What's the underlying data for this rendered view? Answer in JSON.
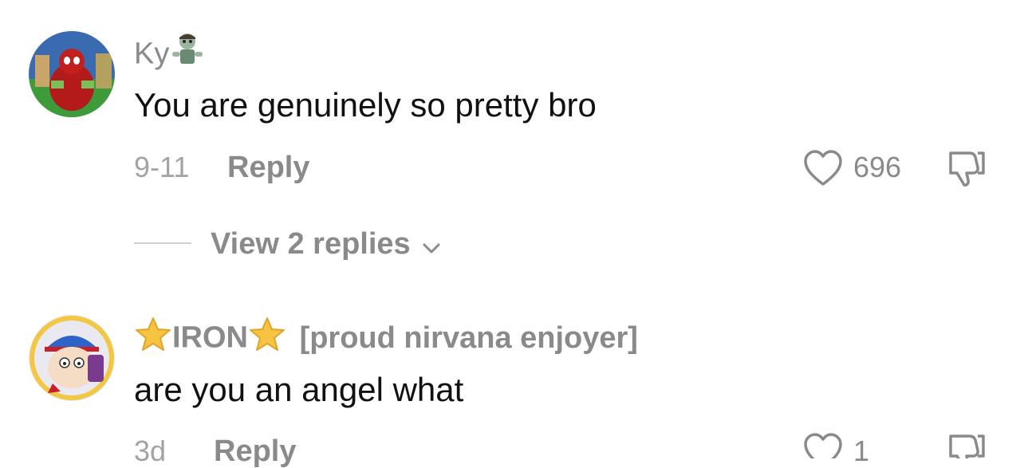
{
  "comments": [
    {
      "username": "Ky",
      "username_emoji": "zombie-icon",
      "text": "You are genuinely so pretty bro",
      "date": "9-11",
      "reply_label": "Reply",
      "likes": "696",
      "view_replies_label": "View 2 replies"
    },
    {
      "username": "IRON",
      "username_prefix_emoji": "star-icon",
      "username_suffix_emoji": "star-icon",
      "tag": "[proud nirvana enjoyer]",
      "text": "are you an angel what",
      "date": "3d",
      "reply_label": "Reply",
      "likes": "1"
    }
  ],
  "colors": {
    "text_primary": "#111111",
    "text_secondary": "#8a8a8a",
    "star": "#f6c343"
  }
}
